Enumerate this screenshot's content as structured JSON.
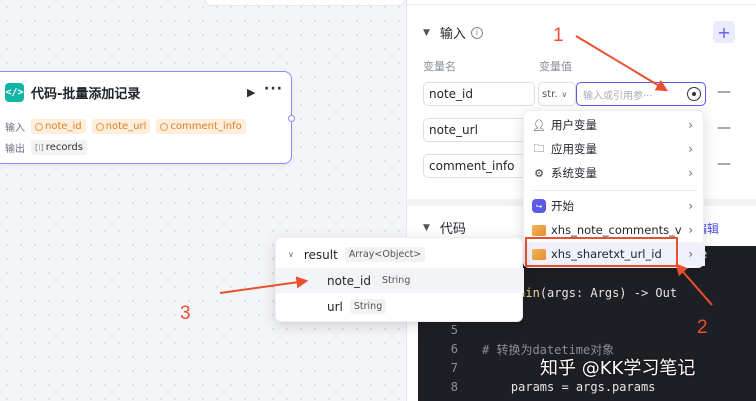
{
  "node": {
    "title": "代码-批量添加记录",
    "input_label": "输入",
    "output_label": "输出",
    "inputs": [
      "note_id",
      "note_url",
      "comment_info"
    ],
    "outputs": [
      "records"
    ]
  },
  "panel": {
    "input_section": "输入",
    "col_name": "变量名",
    "col_value": "变量值",
    "params": [
      {
        "name": "note_id"
      },
      {
        "name": "note_url"
      },
      {
        "name": "comment_info"
      }
    ],
    "type_select": "str.",
    "value_placeholder": "输入或引用参···",
    "code_section": "代码",
    "edit_label": "编辑",
    "snippet_end": "e"
  },
  "dropdown": {
    "items": [
      "用户变量",
      "应用变量",
      "系统变量",
      "开始",
      "xhs_note_comments_v",
      "xhs_sharetxt_url_id"
    ]
  },
  "result_popup": {
    "root": {
      "name": "result",
      "type": "Array<Object>"
    },
    "children": [
      {
        "name": "note_id",
        "type": "String"
      },
      {
        "name": "url",
        "type": "String"
      }
    ]
  },
  "code": {
    "lines": [
      {
        "num": "",
        "text": "def main(args: Args) -> Out"
      },
      {
        "num": "5",
        "text": ""
      },
      {
        "num": "6",
        "text": "# 转换为datetime对象"
      },
      {
        "num": "7",
        "text": ""
      },
      {
        "num": "8",
        "text": "    params = args.params"
      }
    ]
  },
  "annotations": [
    "1",
    "2",
    "3"
  ],
  "watermark": "知乎 @KK学习笔记",
  "colors": {
    "accent": "#5b59e8",
    "annotation": "#e8502f",
    "chip_text": "#e07c20"
  }
}
